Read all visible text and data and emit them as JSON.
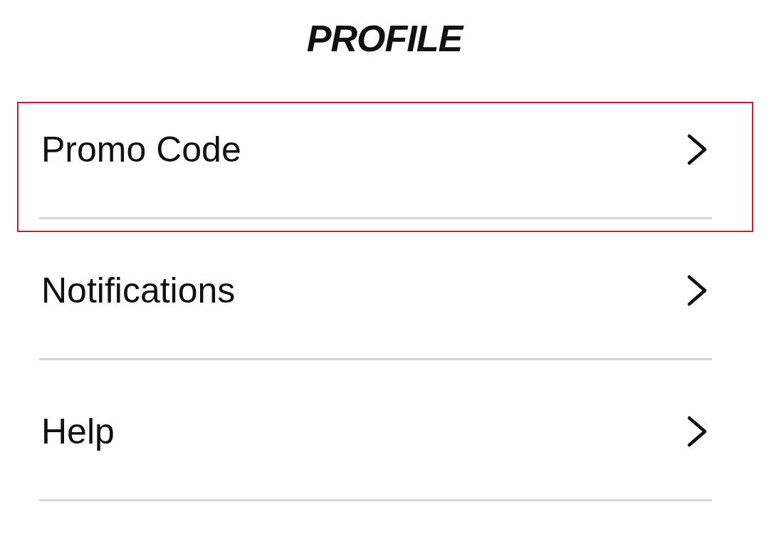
{
  "header": {
    "title": "PROFILE"
  },
  "menu": [
    {
      "label": "Promo Code",
      "selected": true
    },
    {
      "label": "Notifications",
      "selected": false
    },
    {
      "label": "Help",
      "selected": false
    }
  ]
}
